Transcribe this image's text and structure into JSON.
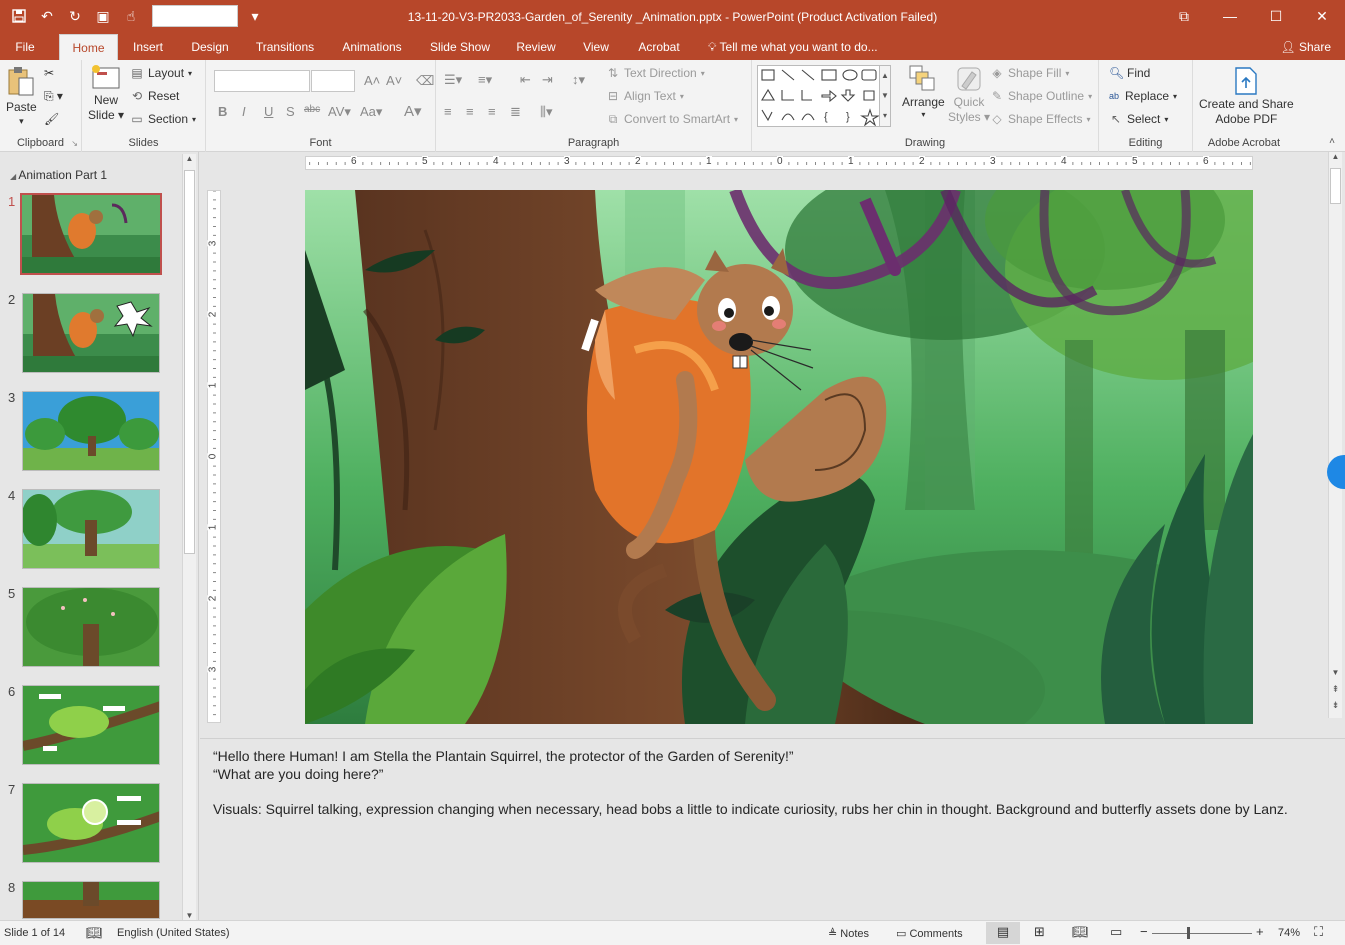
{
  "window": {
    "title": "13-11-20-V3-PR2033-Garden_of_Serenity _Animation.pptx - PowerPoint (Product Activation Failed)"
  },
  "tabs": [
    "File",
    "Home",
    "Insert",
    "Design",
    "Transitions",
    "Animations",
    "Slide Show",
    "Review",
    "View",
    "Acrobat"
  ],
  "active_tab": "Home",
  "tell_me": "Tell me what you want to do...",
  "share": "Share",
  "ribbon": {
    "clipboard": {
      "paste": "Paste",
      "label": "Clipboard"
    },
    "slides": {
      "new_slide_1": "New",
      "new_slide_2": "Slide",
      "layout": "Layout",
      "reset": "Reset",
      "section": "Section",
      "label": "Slides"
    },
    "font": {
      "label": "Font"
    },
    "paragraph": {
      "text_direction": "Text Direction",
      "align_text": "Align Text",
      "convert_smartart": "Convert to SmartArt",
      "label": "Paragraph"
    },
    "drawing": {
      "arrange": "Arrange",
      "quick_1": "Quick",
      "quick_2": "Styles",
      "shape_fill": "Shape Fill",
      "shape_outline": "Shape Outline",
      "shape_effects": "Shape Effects",
      "label": "Drawing"
    },
    "editing": {
      "find": "Find",
      "replace": "Replace",
      "select": "Select",
      "label": "Editing"
    },
    "acrobat": {
      "create_1": "Create and Share",
      "create_2": "Adobe PDF",
      "label": "Adobe Acrobat"
    }
  },
  "slides_pane": {
    "section": "Animation Part 1",
    "thumbs": [
      "1",
      "2",
      "3",
      "4",
      "5",
      "6",
      "7",
      "8"
    ]
  },
  "ruler": {
    "h_labels": [
      "6",
      "5",
      "4",
      "3",
      "2",
      "1",
      "0",
      "1",
      "2",
      "3",
      "4",
      "5",
      "6"
    ],
    "v_labels": [
      "3",
      "2",
      "1",
      "0",
      "1",
      "2",
      "3"
    ]
  },
  "notes": {
    "line1": "“Hello there Human! I am Stella the Plantain Squirrel, the protector of the Garden of Serenity!”",
    "line2": "“What are you doing here?”",
    "line3": "Visuals: Squirrel talking, expression changing when necessary, head bobs a little to indicate curiosity, rubs her chin in thought. Background and butterfly assets done by Lanz."
  },
  "status": {
    "slide": "Slide 1 of 14",
    "language": "English (United States)",
    "notes": "Notes",
    "comments": "Comments",
    "zoom": "74%"
  }
}
